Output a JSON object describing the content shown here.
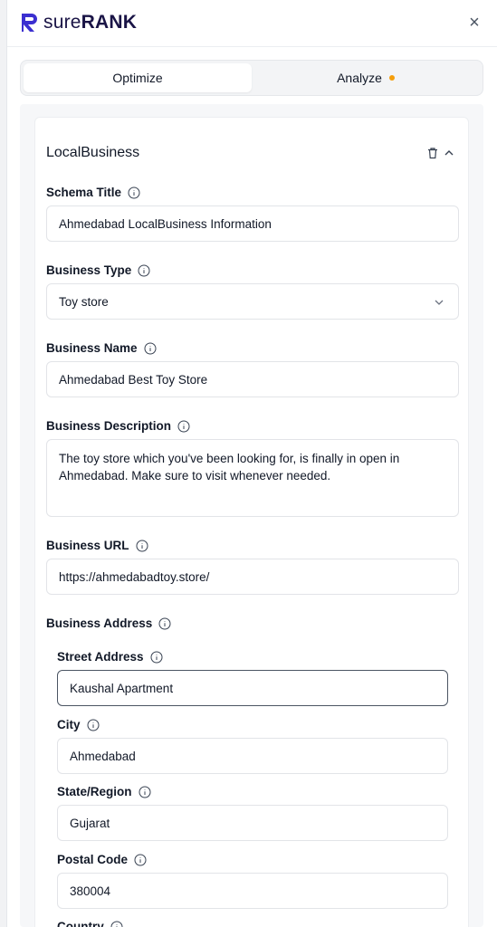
{
  "brand": {
    "name_light": "sure",
    "name_bold": "RANK"
  },
  "header": {
    "close_label": "×"
  },
  "tabs": [
    {
      "label": "Optimize",
      "active": true
    },
    {
      "label": "Analyze",
      "active": false,
      "indicator_color": "#f59e0b"
    }
  ],
  "schema": {
    "title": "LocalBusiness",
    "fields": {
      "schema_title": {
        "label": "Schema Title",
        "value": "Ahmedabad LocalBusiness Information"
      },
      "business_type": {
        "label": "Business Type",
        "value": "Toy store"
      },
      "business_name": {
        "label": "Business Name",
        "value": "Ahmedabad Best Toy Store"
      },
      "business_description": {
        "label": "Business Description",
        "value": "The toy store which you've been looking for, is finally in open in Ahmedabad. Make sure to visit whenever needed."
      },
      "business_url": {
        "label": "Business URL",
        "value": "https://ahmedabadtoy.store/"
      },
      "business_address": {
        "label": "Business Address"
      },
      "street_address": {
        "label": "Street Address",
        "value": "Kaushal Apartment"
      },
      "city": {
        "label": "City",
        "value": "Ahmedabad"
      },
      "state_region": {
        "label": "State/Region",
        "value": "Gujarat"
      },
      "postal_code": {
        "label": "Postal Code",
        "value": "380004"
      },
      "country": {
        "label": "Country"
      }
    }
  },
  "colors": {
    "brand": "#1a1446",
    "accent_dot": "#f59e0b"
  },
  "icons": [
    "surerank-logo-icon",
    "close-icon",
    "trash-icon",
    "chevron-up-icon",
    "info-icon",
    "chevron-down-icon"
  ]
}
